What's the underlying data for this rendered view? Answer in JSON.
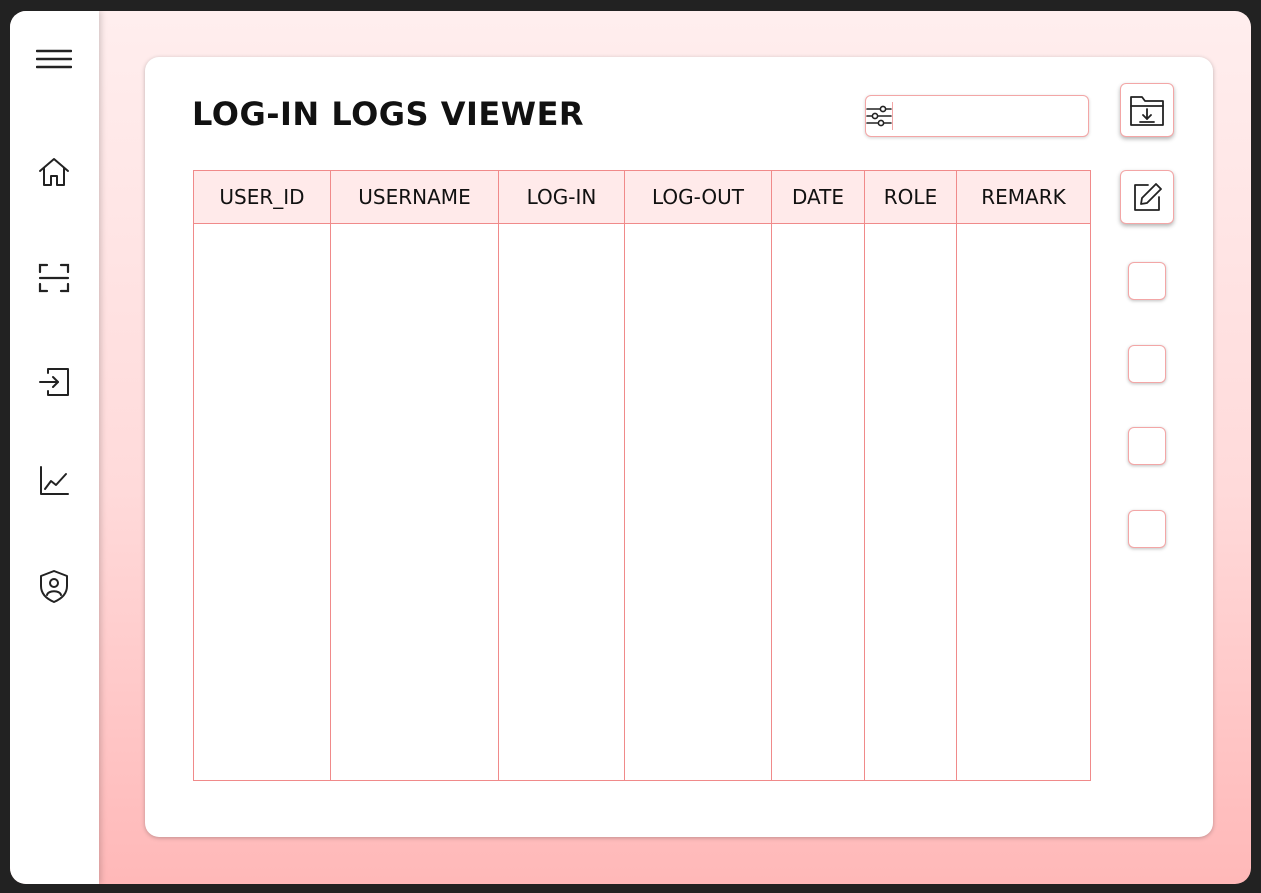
{
  "page": {
    "title": "LOG-IN LOGS VIEWER"
  },
  "sidebar": {
    "items": [
      {
        "icon": "menu-icon"
      },
      {
        "icon": "home-icon"
      },
      {
        "icon": "scan-icon"
      },
      {
        "icon": "login-icon"
      },
      {
        "icon": "chart-icon"
      },
      {
        "icon": "user-shield-icon"
      }
    ]
  },
  "search": {
    "value": "",
    "placeholder": "",
    "filter_icon": "filter-sliders-icon"
  },
  "table": {
    "columns": [
      "USER_ID",
      "USERNAME",
      "LOG-IN",
      "LOG-OUT",
      "DATE",
      "ROLE",
      "REMARK"
    ],
    "rows": []
  },
  "actions": {
    "export_icon": "folder-download-icon",
    "edit_icon": "edit-icon"
  },
  "colors": {
    "accent_border": "#f08a8a",
    "header_bg": "#ffeaea",
    "background_top": "#ffeeee",
    "background_bottom": "#ffb8b8"
  }
}
